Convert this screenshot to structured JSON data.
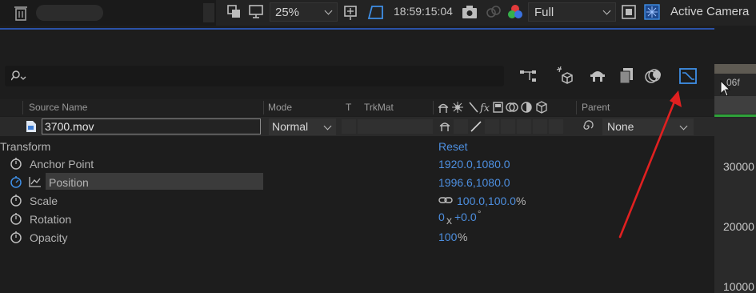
{
  "viewer_bar": {
    "zoom": "25%",
    "timecode": "18:59:15:04",
    "resolution": "Full",
    "camera": "Active Camera"
  },
  "timeline": {
    "ruler_label": "06f",
    "graph_ticks": [
      "30000",
      "20000",
      "10000"
    ]
  },
  "columns": {
    "source_name": "Source Name",
    "mode": "Mode",
    "t": "T",
    "trkmat": "TrkMat",
    "parent": "Parent"
  },
  "layer": {
    "name": "3700.mov",
    "mode": "Normal",
    "parent": "None"
  },
  "transform": {
    "label": "Transform",
    "reset": "Reset",
    "properties": [
      {
        "name": "Anchor Point",
        "value": "1920.0,1080.0"
      },
      {
        "name": "Position",
        "value": "1996.6,1080.0"
      },
      {
        "name": "Scale",
        "value": "100.0,100.0",
        "unit": "%"
      },
      {
        "name": "Rotation",
        "value_a": "0",
        "unit_a": "x",
        "value_b": "+0.0",
        "unit_b": "°"
      },
      {
        "name": "Opacity",
        "value": "100",
        "unit": "%"
      }
    ]
  },
  "colors": {
    "accent_blue": "#4d8fe0",
    "annotation_arrow": "#e02020",
    "in_out_bar": "#2fa33a"
  }
}
